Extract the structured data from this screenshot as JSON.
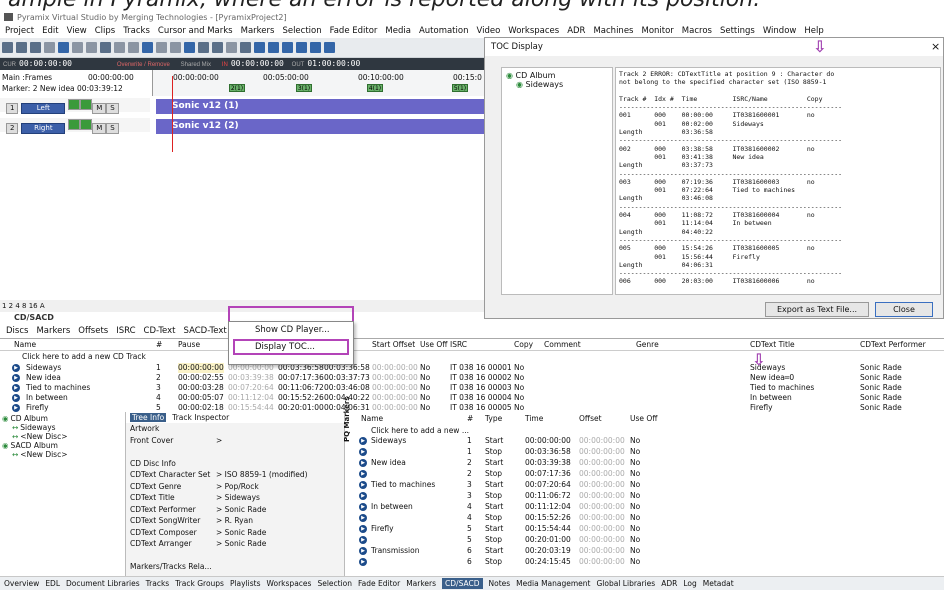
{
  "caption": "ample in Pyramix, where an error is reported along with its position.",
  "window_title": "Pyramix Virtual Studio by Merging Technologies - [PyramixProject2]",
  "menu": [
    "Project",
    "Edit",
    "View",
    "Clips",
    "Tracks",
    "Cursor and Marks",
    "Markers",
    "Selection",
    "Fade Editor",
    "Media",
    "Automation",
    "Video",
    "Workspaces",
    "ADR",
    "Machines",
    "Monitor",
    "Macros",
    "Settings",
    "Window",
    "Help"
  ],
  "transport": {
    "cur_label": "CUR",
    "cur": "00:00:00:00",
    "mode1": "Overwrite / Remove",
    "mode2": "Shared Mix",
    "in_label": "IN",
    "in": "00:00:00:00",
    "out_label": "OUT",
    "out": "01:00:00:00"
  },
  "timeline": {
    "main_frames": "Main :Frames",
    "main_time": "00:00:00:00",
    "marker_info": "Marker: 2 New idea 00:03:39:12",
    "ruler": [
      "00:00:00:00",
      "00:05:00:00",
      "00:10:00:00",
      "00:15:0"
    ],
    "markers": [
      "2(1)",
      "3(1)",
      "4(1)",
      "5(1)"
    ]
  },
  "tracks": [
    {
      "num": "1",
      "name": "Left",
      "clip": "Sonic v12 (1)"
    },
    {
      "num": "2",
      "name": "Right",
      "clip": "Sonic v12 (2)"
    }
  ],
  "zoom_text": "1 2 4 8 16 A",
  "cd_header": "CD/SACD",
  "cd_tabs": [
    "Discs",
    "Markers",
    "Offsets",
    "ISRC",
    "CD-Text",
    "SACD-Text",
    "View"
  ],
  "view_menu": [
    "Show CD Player...",
    "Display TOC..."
  ],
  "track_table": {
    "headers": [
      "Name",
      "#",
      "Pause",
      "Start",
      "End",
      "Length",
      "Start Offset",
      "Use Off",
      "ISRC",
      "Copy",
      "Comment",
      "Genre",
      "CDText Title",
      "CDText Performer"
    ],
    "add_row": "Click here to add a new CD Track",
    "rows": [
      [
        "Sideways",
        "1",
        "00:00:00:00",
        "00:00:00:00",
        "00:03:36:58",
        "00:03:36:58",
        "00:00:00:00",
        "No",
        "IT 038 16 00001",
        "No",
        "",
        "",
        "Sideways",
        "Sonic Rade"
      ],
      [
        "New idea",
        "2",
        "00:00:02:55",
        "00:03:39:38",
        "00:07:17:36",
        "00:03:37:73",
        "00:00:00:00",
        "No",
        "IT 038 16 00002",
        "No",
        "",
        "",
        "New idea═0",
        "Sonic Rade"
      ],
      [
        "Tied to machines",
        "3",
        "00:00:03:28",
        "00:07:20:64",
        "00:11:06:72",
        "00:03:46:08",
        "00:00:00:00",
        "No",
        "IT 038 16 00003",
        "No",
        "",
        "",
        "Tied to machines",
        "Sonic Rade"
      ],
      [
        "In between",
        "4",
        "00:00:05:07",
        "00:11:12:04",
        "00:15:52:26",
        "00:04:40:22",
        "00:00:00:00",
        "No",
        "IT 038 16 00004",
        "No",
        "",
        "",
        "In between",
        "Sonic Rade"
      ],
      [
        "Firefly",
        "5",
        "00:00:02:18",
        "00:15:54:44",
        "00:20:01:00",
        "00:04:06:31",
        "00:00:00:00",
        "No",
        "IT 038 16 00005",
        "No",
        "",
        "",
        "Firefly",
        "Sonic Rade"
      ]
    ]
  },
  "album_tree": [
    "CD Album",
    "Sideways",
    "<New Disc>",
    "SACD Album",
    "<New Disc>"
  ],
  "tree_tabs": [
    "Tree Info",
    "Track Inspector"
  ],
  "tree_info": [
    [
      "Artwork",
      ""
    ],
    [
      "Front Cover",
      ">"
    ],
    [
      "",
      ""
    ],
    [
      "CD Disc Info",
      ""
    ],
    [
      "CDText Character Set",
      "> ISO 8859-1 (modified)"
    ],
    [
      "CDText Genre",
      "> Pop/Rock"
    ],
    [
      "CDText Title",
      "> Sideways"
    ],
    [
      "CDText Performer",
      "> Sonic Rade"
    ],
    [
      "CDText SongWriter",
      "> R. Ryan"
    ],
    [
      "CDText Composer",
      "> Sonic Rade"
    ],
    [
      "CDText Arranger",
      "> Sonic Rade"
    ],
    [
      "",
      ""
    ],
    [
      "Markers/Tracks Rela...",
      ""
    ]
  ],
  "pq_label": "PQ Markers",
  "pq_table": {
    "headers": [
      "Name",
      "#",
      "Type",
      "Time",
      "Offset",
      "Use Off"
    ],
    "add_row": "Click here to add a new ...",
    "rows": [
      [
        "Sideways",
        "1",
        "Start",
        "00:00:00:00",
        "00:00:00:00",
        "No"
      ],
      [
        "",
        "1",
        "Stop",
        "00:03:36:58",
        "00:00:00:00",
        "No"
      ],
      [
        "New idea",
        "2",
        "Start",
        "00:03:39:38",
        "00:00:00:00",
        "No"
      ],
      [
        "",
        "2",
        "Stop",
        "00:07:17:36",
        "00:00:00:00",
        "No"
      ],
      [
        "Tied to machines",
        "3",
        "Start",
        "00:07:20:64",
        "00:00:00:00",
        "No"
      ],
      [
        "",
        "3",
        "Stop",
        "00:11:06:72",
        "00:00:00:00",
        "No"
      ],
      [
        "In between",
        "4",
        "Start",
        "00:11:12:04",
        "00:00:00:00",
        "No"
      ],
      [
        "",
        "4",
        "Stop",
        "00:15:52:26",
        "00:00:00:00",
        "No"
      ],
      [
        "Firefly",
        "5",
        "Start",
        "00:15:54:44",
        "00:00:00:00",
        "No"
      ],
      [
        "",
        "5",
        "Stop",
        "00:20:01:00",
        "00:00:00:00",
        "No"
      ],
      [
        "Transmission",
        "6",
        "Start",
        "00:20:03:19",
        "00:00:00:00",
        "No"
      ],
      [
        "",
        "6",
        "Stop",
        "00:24:15:45",
        "00:00:00:00",
        "No"
      ]
    ]
  },
  "statusbar": [
    "Overview",
    "EDL",
    "Document Libraries",
    "Tracks",
    "Track Groups",
    "Playlists",
    "Workspaces",
    "Selection",
    "Fade Editor",
    "Markers",
    "CD/SACD",
    "Notes",
    "Media Management",
    "Global Libraries",
    "ADR",
    "Log",
    "Metadat"
  ],
  "toc": {
    "title": "TOC Display",
    "tree": [
      "CD Album",
      "Sideways"
    ],
    "text": "Track 2 ERROR: CDTextTitle at position 9 : Character do\nnot belong to the specified character set (ISO 8859-1\n\nTrack #  Idx #  Time         ISRC/Name          Copy\n---------------------------------------------------------\n001      000    00:00:00     IT0381600001       no\n         001    00:02:00     Sideways\nLength          03:36:58\n---------------------------------------------------------\n002      000    03:38:58     IT0381600002       no\n         001    03:41:38     New idea\nLength          03:37:73\n---------------------------------------------------------\n003      000    07:19:36     IT0381600003       no\n         001    07:22:64     Tied to machines\nLength          03:46:08\n---------------------------------------------------------\n004      000    11:08:72     IT0381600004       no\n         001    11:14:04     In between\nLength          04:40:22\n---------------------------------------------------------\n005      000    15:54:26     IT0381600005       no\n         001    15:56:44     Firefly\nLength          04:06:31\n---------------------------------------------------------\n006      000    20:03:00     IT0381600006       no",
    "export_button": "Export as Text File...",
    "close_button": "Close"
  },
  "colors": {
    "accent": "#b344b8",
    "clip": "#6a66c8",
    "transport": "#2f3740"
  }
}
